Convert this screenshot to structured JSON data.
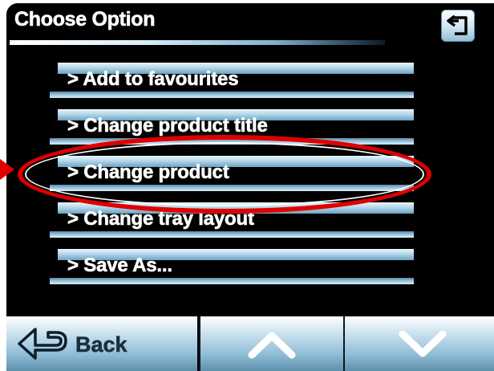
{
  "header": {
    "title": "Choose Option",
    "return_icon": "return-arrow-icon"
  },
  "menu": {
    "items": [
      {
        "label": "> Add to favourites"
      },
      {
        "label": "> Change product title"
      },
      {
        "label": "> Change product",
        "selected": true
      },
      {
        "label": "> Change tray layout"
      },
      {
        "label": "> Save As..."
      }
    ]
  },
  "nav": {
    "back_label": "Back",
    "back_icon": "back-arrow-icon",
    "up_icon": "chevron-up-icon",
    "down_icon": "chevron-down-icon"
  },
  "colors": {
    "background": "#000000",
    "highlight": "#e00000",
    "button_light": "#cde3f0",
    "button_dark": "#5e8fab"
  }
}
